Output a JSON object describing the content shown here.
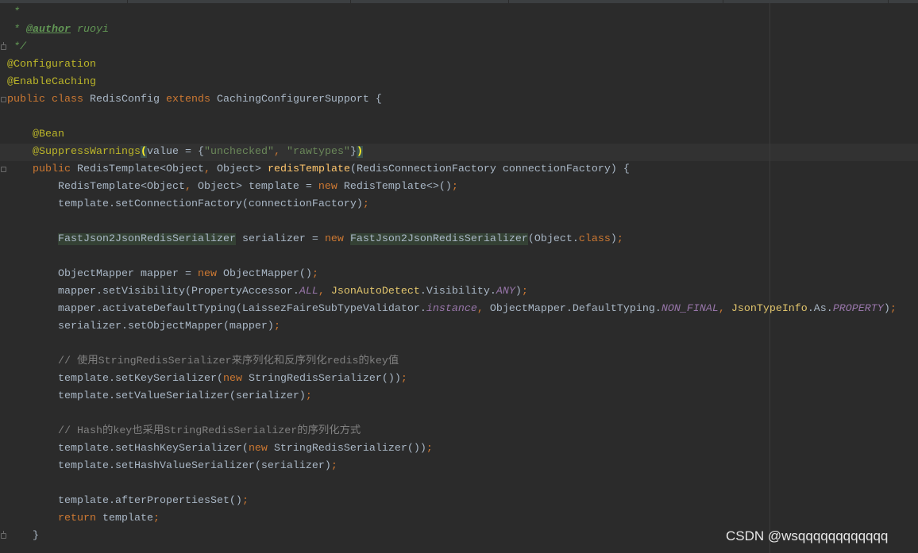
{
  "theme": {
    "background": "#2b2b2b",
    "text": "#a9b7c6",
    "keyword": "#cc7832",
    "annotation": "#bbb529",
    "string": "#6a8759",
    "comment": "#808080",
    "javadoc": "#629755",
    "method": "#ffc66d",
    "static_field": "#9876aa"
  },
  "editor": {
    "lines": [
      [
        {
          "t": " *",
          "k": "javadoc"
        }
      ],
      [
        {
          "t": " * ",
          "k": "javadoc"
        },
        {
          "t": "@author",
          "k": "javadoc-tag"
        },
        {
          "t": " ruoyi",
          "k": "javadoc"
        }
      ],
      [
        {
          "t": " */",
          "k": "javadoc"
        }
      ],
      [
        {
          "t": "@Configuration",
          "k": "annotation"
        }
      ],
      [
        {
          "t": "@EnableCaching",
          "k": "annotation"
        }
      ],
      [
        {
          "t": "public class ",
          "k": "keyword"
        },
        {
          "t": "RedisConfig ",
          "k": "plain"
        },
        {
          "t": "extends ",
          "k": "keyword"
        },
        {
          "t": "CachingConfigurerSupport {",
          "k": "plain"
        }
      ],
      [],
      [
        {
          "t": "    ",
          "k": "plain"
        },
        {
          "t": "@Bean",
          "k": "annotation"
        }
      ],
      [
        {
          "t": "    ",
          "k": "plain"
        },
        {
          "t": "@SuppressWarnings",
          "k": "annotation"
        },
        {
          "t": "(",
          "k": "brace"
        },
        {
          "t": "value = {",
          "k": "plain"
        },
        {
          "t": "\"unchecked\"",
          "k": "string"
        },
        {
          "t": ", ",
          "k": "comma"
        },
        {
          "t": "\"rawtypes\"",
          "k": "string"
        },
        {
          "t": "}",
          "k": "plain"
        },
        {
          "t": ")",
          "k": "brace"
        }
      ],
      [
        {
          "t": "    ",
          "k": "plain"
        },
        {
          "t": "public ",
          "k": "keyword"
        },
        {
          "t": "RedisTemplate<Object",
          "k": "plain"
        },
        {
          "t": ", ",
          "k": "comma"
        },
        {
          "t": "Object> ",
          "k": "plain"
        },
        {
          "t": "redisTemplate",
          "k": "method"
        },
        {
          "t": "(RedisConnectionFactory connectionFactory) {",
          "k": "plain"
        }
      ],
      [
        {
          "t": "        RedisTemplate<Object",
          "k": "plain"
        },
        {
          "t": ", ",
          "k": "comma"
        },
        {
          "t": "Object> template = ",
          "k": "plain"
        },
        {
          "t": "new ",
          "k": "keyword"
        },
        {
          "t": "RedisTemplate<>()",
          "k": "plain"
        },
        {
          "t": ";",
          "k": "comma"
        }
      ],
      [
        {
          "t": "        template.setConnectionFactory(connectionFactory)",
          "k": "plain"
        },
        {
          "t": ";",
          "k": "comma"
        }
      ],
      [],
      [
        {
          "t": "        ",
          "k": "plain"
        },
        {
          "t": "FastJson2JsonRedisSerializer",
          "k": "type-hl"
        },
        {
          "t": " serializer = ",
          "k": "plain"
        },
        {
          "t": "new ",
          "k": "keyword"
        },
        {
          "t": "FastJson2JsonRedisSerializer",
          "k": "type-hl"
        },
        {
          "t": "(Object.",
          "k": "plain"
        },
        {
          "t": "class",
          "k": "keyword"
        },
        {
          "t": ")",
          "k": "plain"
        },
        {
          "t": ";",
          "k": "comma"
        }
      ],
      [],
      [
        {
          "t": "        ObjectMapper mapper = ",
          "k": "plain"
        },
        {
          "t": "new ",
          "k": "keyword"
        },
        {
          "t": "ObjectMapper()",
          "k": "plain"
        },
        {
          "t": ";",
          "k": "comma"
        }
      ],
      [
        {
          "t": "        mapper.setVisibility(PropertyAccessor.",
          "k": "plain"
        },
        {
          "t": "ALL",
          "k": "static"
        },
        {
          "t": ", ",
          "k": "comma"
        },
        {
          "t": "JsonAutoDetect",
          "k": "warn"
        },
        {
          "t": ".Visibility.",
          "k": "plain"
        },
        {
          "t": "ANY",
          "k": "static"
        },
        {
          "t": ")",
          "k": "plain"
        },
        {
          "t": ";",
          "k": "comma"
        }
      ],
      [
        {
          "t": "        mapper.activateDefaultTyping(LaissezFaireSubTypeValidator.",
          "k": "plain"
        },
        {
          "t": "instance",
          "k": "static"
        },
        {
          "t": ", ",
          "k": "comma"
        },
        {
          "t": "ObjectMapper.DefaultTyping.",
          "k": "plain"
        },
        {
          "t": "NON_FINAL",
          "k": "static"
        },
        {
          "t": ", ",
          "k": "comma"
        },
        {
          "t": "JsonTypeInfo",
          "k": "warn"
        },
        {
          "t": ".As.",
          "k": "plain"
        },
        {
          "t": "PROPERTY",
          "k": "static"
        },
        {
          "t": ")",
          "k": "plain"
        },
        {
          "t": ";",
          "k": "comma"
        }
      ],
      [
        {
          "t": "        serializer.setObjectMapper(mapper)",
          "k": "plain"
        },
        {
          "t": ";",
          "k": "comma"
        }
      ],
      [],
      [
        {
          "t": "        ",
          "k": "plain"
        },
        {
          "t": "// 使用StringRedisSerializer来序列化和反序列化redis的key值",
          "k": "comment"
        }
      ],
      [
        {
          "t": "        template.setKeySerializer(",
          "k": "plain"
        },
        {
          "t": "new ",
          "k": "keyword"
        },
        {
          "t": "StringRedisSerializer())",
          "k": "plain"
        },
        {
          "t": ";",
          "k": "comma"
        }
      ],
      [
        {
          "t": "        template.setValueSerializer(serializer)",
          "k": "plain"
        },
        {
          "t": ";",
          "k": "comma"
        }
      ],
      [],
      [
        {
          "t": "        ",
          "k": "plain"
        },
        {
          "t": "// Hash的key也采用StringRedisSerializer的序列化方式",
          "k": "comment"
        }
      ],
      [
        {
          "t": "        template.setHashKeySerializer(",
          "k": "plain"
        },
        {
          "t": "new ",
          "k": "keyword"
        },
        {
          "t": "StringRedisSerializer())",
          "k": "plain"
        },
        {
          "t": ";",
          "k": "comma"
        }
      ],
      [
        {
          "t": "        template.setHashValueSerializer(serializer)",
          "k": "plain"
        },
        {
          "t": ";",
          "k": "comma"
        }
      ],
      [],
      [
        {
          "t": "        template.afterPropertiesSet()",
          "k": "plain"
        },
        {
          "t": ";",
          "k": "comma"
        }
      ],
      [
        {
          "t": "        ",
          "k": "plain"
        },
        {
          "t": "return ",
          "k": "keyword"
        },
        {
          "t": "template",
          "k": "plain"
        },
        {
          "t": ";",
          "k": "comma"
        }
      ],
      [
        {
          "t": "    }",
          "k": "plain"
        }
      ]
    ]
  },
  "watermark": {
    "text": "CSDN @wsqqqqqqqqqqqq"
  }
}
